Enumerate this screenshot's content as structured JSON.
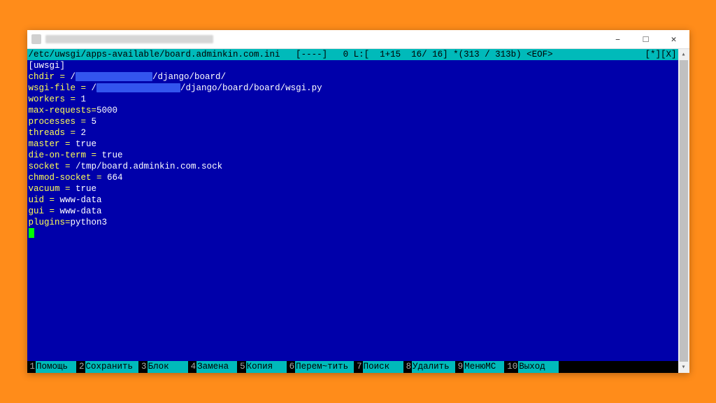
{
  "info_bar": {
    "left": "/etc/uwsgi/apps-available/board.adminkin.com.ini   [----]   0 L:[  1+15  16/ 16] *(313 / 313b) <EOF>",
    "right": "[*][X]"
  },
  "content": {
    "section": "[uwsgi]",
    "lines": [
      {
        "key": "chdir",
        "sep": " = ",
        "prefix": "/",
        "redact_w": 110,
        "suffix": "/django/board/"
      },
      {
        "key": "wsgi-file",
        "sep": " = ",
        "prefix": "/",
        "redact_w": 120,
        "suffix": "/django/board/board/wsgi.py"
      },
      {
        "key": "workers",
        "sep": " = ",
        "val": "1"
      },
      {
        "key": "max-requests",
        "sep": "=",
        "val": "5000"
      },
      {
        "key": "processes",
        "sep": " = ",
        "val": "5"
      },
      {
        "key": "threads",
        "sep": " = ",
        "val": "2"
      },
      {
        "key": "master",
        "sep": " = ",
        "val": "true"
      },
      {
        "key": "die-on-term",
        "sep": " = ",
        "val": "true"
      },
      {
        "key": "socket",
        "sep": " = ",
        "val": "/tmp/board.adminkin.com.sock"
      },
      {
        "key": "chmod-socket",
        "sep": " = ",
        "val": "664"
      },
      {
        "key": "vacuum",
        "sep": " = ",
        "val": "true"
      },
      {
        "key": "uid",
        "sep": " = ",
        "val": "www-data"
      },
      {
        "key": "gui",
        "sep": " = ",
        "val": "www-data"
      },
      {
        "key": "plugins",
        "sep": "=",
        "val": "python3"
      }
    ]
  },
  "fkeys": [
    {
      "n": "1",
      "label": "Помощь"
    },
    {
      "n": "2",
      "label": "Сохранить"
    },
    {
      "n": "3",
      "label": "Блок"
    },
    {
      "n": "4",
      "label": "Замена"
    },
    {
      "n": "5",
      "label": "Копия"
    },
    {
      "n": "6",
      "label": "Перем~тить"
    },
    {
      "n": "7",
      "label": "Поиск"
    },
    {
      "n": "8",
      "label": "Удалить"
    },
    {
      "n": "9",
      "label": "МенюMC"
    },
    {
      "n": "10",
      "label": "Выход"
    }
  ]
}
